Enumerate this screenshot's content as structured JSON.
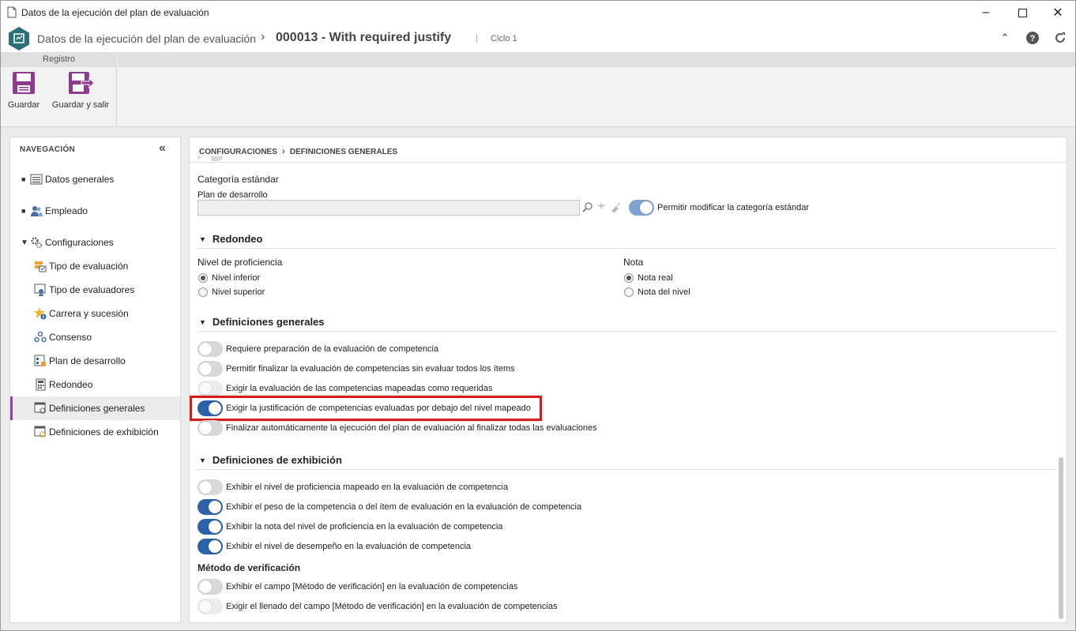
{
  "window": {
    "title": "Datos de la ejecución del plan de evaluación",
    "controls": [
      "minimize-icon",
      "maximize-icon",
      "close-icon"
    ]
  },
  "header": {
    "module_title": "Datos de la ejecución del plan de evaluación",
    "record_title": "000013 - With required justify",
    "separator": "|",
    "cycle": "Ciclo 1"
  },
  "ribbon": {
    "group_label": "Registro",
    "save_label": "Guardar",
    "save_exit_label": "Guardar y salir"
  },
  "nav": {
    "heading": "NAVEGACIÓN",
    "items": [
      {
        "label": "Datos generales",
        "icon": "list-icon"
      },
      {
        "label": "Empleado",
        "icon": "users-icon"
      },
      {
        "label": "Configuraciones",
        "icon": "gears-icon"
      }
    ],
    "sub_items": [
      {
        "label": "Tipo de evaluación",
        "icon": "evaluation-type-icon"
      },
      {
        "label": "Tipo de evaluadores",
        "icon": "evaluators-icon"
      },
      {
        "label": "Carrera y sucesión",
        "icon": "star-icon"
      },
      {
        "label": "Consenso",
        "icon": "consensus-icon"
      },
      {
        "label": "Plan de desarrollo",
        "icon": "development-plan-icon"
      },
      {
        "label": "Redondeo",
        "icon": "calculator-icon"
      },
      {
        "label": "Definiciones generales",
        "icon": "settings-window-icon",
        "selected": true
      },
      {
        "label": "Definiciones de exhibición",
        "icon": "display-settings-icon"
      }
    ]
  },
  "breadcrumb": {
    "part1": "CONFIGURACIONES",
    "part2": "DEFINICIONES GENERALES"
  },
  "category": {
    "title": "Categoría estándar",
    "field_label": "Plan de desarrollo",
    "field_value": "",
    "toggle_label": "Permitir modificar la categoría estándar",
    "toggle_on": true
  },
  "rounding": {
    "title": "Redondeo",
    "proficiency_label": "Nivel de proficiencia",
    "proficiency_options": [
      "Nivel inferior",
      "Nivel superior"
    ],
    "proficiency_selected": 0,
    "grade_label": "Nota",
    "grade_options": [
      "Nota real",
      "Nota del nivel"
    ],
    "grade_selected": 0
  },
  "general": {
    "title": "Definiciones generales",
    "toggles": [
      {
        "label": "Requiere preparación de la evaluación de competencia",
        "state": "off"
      },
      {
        "label": "Permitir finalizar la evaluación de competencias sin evaluar todos los ítems",
        "state": "off"
      },
      {
        "label": "Exigir la evaluación de las competencias mapeadas como requeridas",
        "state": "disabled"
      },
      {
        "label": "Exigir la justificación de competencias evaluadas por debajo del nivel mapeado",
        "state": "on"
      },
      {
        "label": "Finalizar automáticamente la ejecución del plan de evaluación al finalizar todas las evaluaciones",
        "state": "off"
      }
    ]
  },
  "display": {
    "title": "Definiciones de exhibición",
    "toggles": [
      {
        "label": "Exhibir el nivel de proficiencia mapeado en la evaluación de competencia",
        "state": "off"
      },
      {
        "label": "Exhibir el peso de la competencia o del ítem de evaluación en la evaluación de competencia",
        "state": "on"
      },
      {
        "label": "Exhibir la nota del nivel de proficiencia en la evaluación de competencia",
        "state": "on"
      },
      {
        "label": "Exhibir el nivel de desempeño en la evaluación de competencia",
        "state": "on"
      }
    ],
    "verification_title": "Método de verificación",
    "verification_toggles": [
      {
        "label": "Exhibir el campo [Método de verificación] en la evaluación de competencias",
        "state": "off"
      },
      {
        "label": "Exigir el llenado del campo [Método de verificación] en la evaluación de competencias",
        "state": "disabled"
      }
    ]
  },
  "colors": {
    "accent": "#2e62a8",
    "highlight": "#d81b1b",
    "nav_selected_bar": "#8e44ad",
    "brand": "#2b6f77",
    "ribbon_icon": "#8e3a8e"
  }
}
